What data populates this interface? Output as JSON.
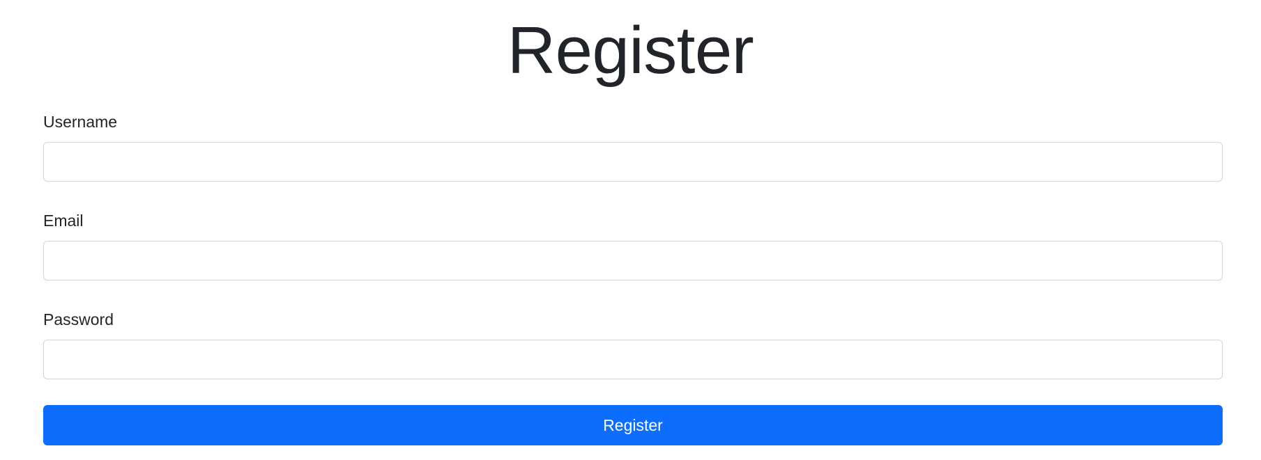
{
  "page": {
    "title": "Register"
  },
  "form": {
    "username": {
      "label": "Username",
      "value": "",
      "placeholder": ""
    },
    "email": {
      "label": "Email",
      "value": "",
      "placeholder": ""
    },
    "password": {
      "label": "Password",
      "value": "",
      "placeholder": ""
    },
    "submit_label": "Register"
  },
  "colors": {
    "primary": "#0d6efd",
    "text": "#212529",
    "input_border": "#ced4da"
  }
}
